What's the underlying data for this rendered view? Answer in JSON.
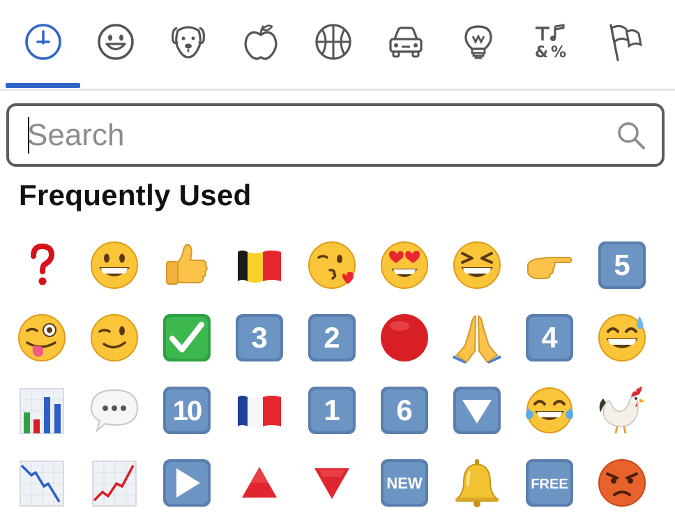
{
  "tabs": [
    {
      "label": "Frequently Used",
      "icon": "clock-icon",
      "selected": true
    },
    {
      "label": "Smileys & People",
      "icon": "smiley-icon"
    },
    {
      "label": "Animals & Nature",
      "icon": "dog-icon"
    },
    {
      "label": "Food & Drink",
      "icon": "apple-icon"
    },
    {
      "label": "Activity",
      "icon": "basketball-icon"
    },
    {
      "label": "Travel & Places",
      "icon": "car-icon"
    },
    {
      "label": "Objects",
      "icon": "lightbulb-icon"
    },
    {
      "label": "Symbols",
      "icon": "symbols-icon"
    },
    {
      "label": "Flags",
      "icon": "flag-icon"
    }
  ],
  "colors": {
    "accent": "#2f64c9",
    "tab_icon": "#555555",
    "keycap": "#5f86b8"
  },
  "search": {
    "placeholder": "Search",
    "value": ""
  },
  "section": {
    "title": "Frequently Used"
  },
  "emojis": [
    [
      "❓",
      "😀",
      "👍",
      "🇧🇪",
      "😘",
      "😍",
      "😆",
      "👉",
      "5️⃣"
    ],
    [
      "😜",
      "😉",
      "✅",
      "3️⃣",
      "2️⃣",
      "🔴",
      "🙏",
      "4️⃣",
      "😅"
    ],
    [
      "📊",
      "💬",
      "🔟",
      "🇫🇷",
      "1️⃣",
      "6️⃣",
      "🔽",
      "😂",
      "🐓"
    ],
    [
      "📉",
      "📈",
      "▶️",
      "🔺",
      "🔻",
      "🆕",
      "🔔",
      "🆓",
      "😡"
    ]
  ],
  "keycap_labels": {
    "five": "5",
    "three": "3",
    "two": "2",
    "four": "4",
    "ten": "10",
    "one": "1",
    "six": "6",
    "new": "NEW",
    "free": "FREE"
  }
}
